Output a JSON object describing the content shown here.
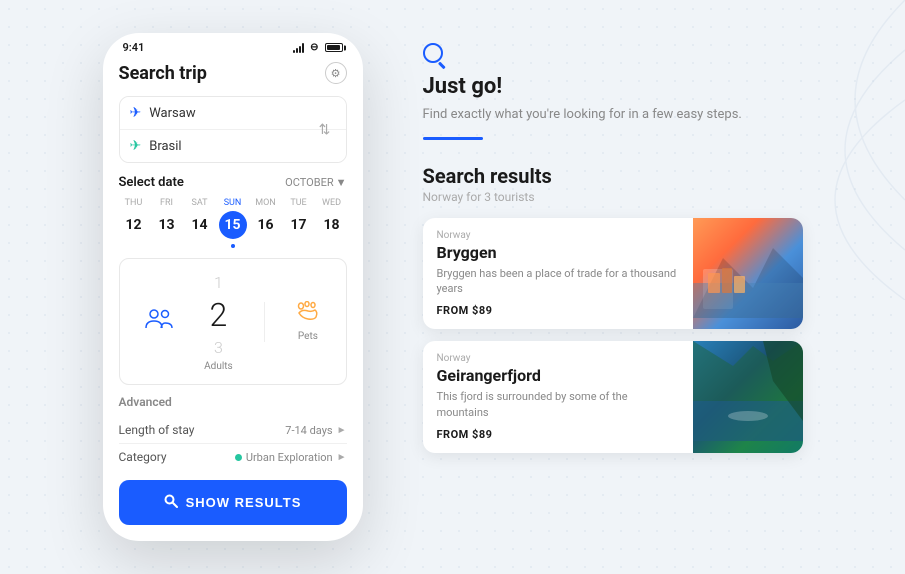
{
  "statusBar": {
    "time": "9:41"
  },
  "phone": {
    "title": "Search trip",
    "origin": "Warsaw",
    "destination": "Brasil",
    "dateLabel": "Select date",
    "month": "OCTOBER",
    "days": [
      {
        "name": "THU",
        "num": "12",
        "selected": false
      },
      {
        "name": "FRI",
        "num": "13",
        "selected": false
      },
      {
        "name": "SAT",
        "num": "14",
        "selected": false
      },
      {
        "name": "SUN",
        "num": "15",
        "selected": true
      },
      {
        "name": "MON",
        "num": "16",
        "selected": false
      },
      {
        "name": "TUE",
        "num": "17",
        "selected": false
      },
      {
        "name": "WED",
        "num": "18",
        "selected": false
      }
    ],
    "passengers": {
      "adults": {
        "label": "Adults",
        "count": "2"
      },
      "pets": {
        "label": "Pets"
      }
    },
    "scrollNumbers": {
      "above": "1",
      "current": "2",
      "below": "3"
    },
    "advanced": {
      "label": "Advanced",
      "lengthOfStay": {
        "label": "Length of stay",
        "value": "7-14 days"
      },
      "category": {
        "label": "Category",
        "value": "Urban Exploration"
      }
    },
    "showResultsButton": "SHOW RESULTS"
  },
  "rightPanel": {
    "justGo": {
      "title": "Just go!",
      "description": "Find exactly what you're looking for in a few easy steps."
    },
    "searchResults": {
      "title": "Search results",
      "subtitle": "Norway for 3 tourists",
      "results": [
        {
          "country": "Norway",
          "name": "Bryggen",
          "description": "Bryggen has been a place of trade for a thousand years",
          "price": "FROM $89",
          "imageClass": "bryggen-img"
        },
        {
          "country": "Norway",
          "name": "Geirangerfjord",
          "description": "This fjord is surrounded by some of the mountains",
          "price": "FROM $89",
          "imageClass": "fjord-img"
        }
      ]
    }
  }
}
